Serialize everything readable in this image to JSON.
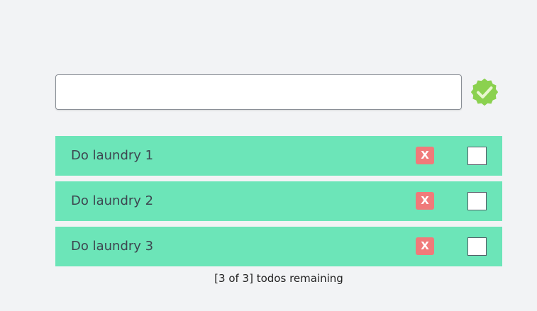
{
  "new_todo": {
    "value": "",
    "placeholder": ""
  },
  "add_button": {
    "icon": "check-badge-icon",
    "color": "#8bd14f"
  },
  "colors": {
    "todo_background": "#6ce5b8",
    "delete_button": "#f07a7a"
  },
  "todos": [
    {
      "label": "Do laundry 1",
      "delete_label": "X",
      "done": false
    },
    {
      "label": "Do laundry 2",
      "delete_label": "X",
      "done": false
    },
    {
      "label": "Do laundry 3",
      "delete_label": "X",
      "done": false
    }
  ],
  "footer": {
    "remaining_text": "[3 of 3] todos remaining"
  }
}
